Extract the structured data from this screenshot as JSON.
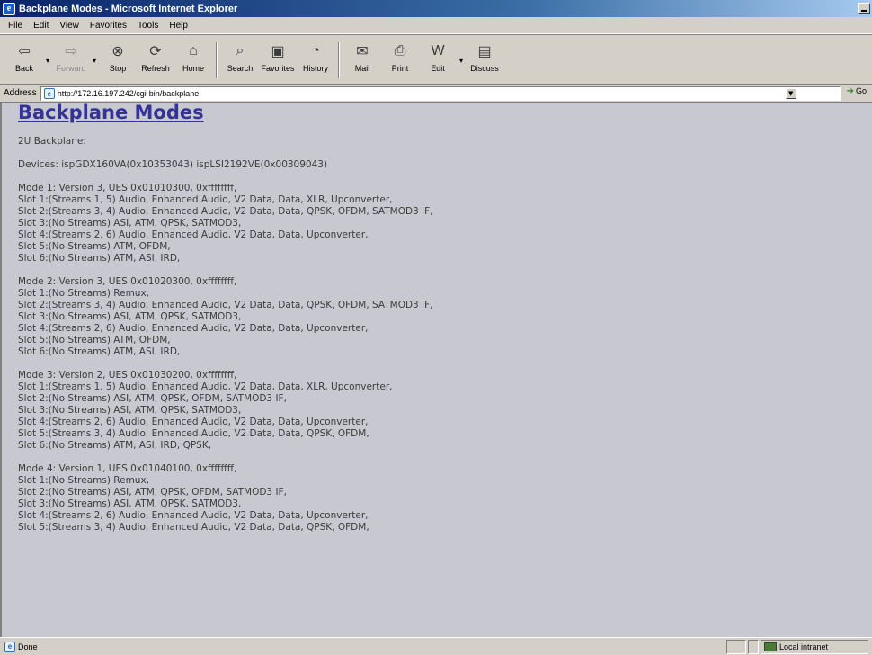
{
  "window": {
    "title": "Backplane Modes - Microsoft Internet Explorer"
  },
  "menu": [
    "File",
    "Edit",
    "View",
    "Favorites",
    "Tools",
    "Help"
  ],
  "toolbar": {
    "back": "Back",
    "forward": "Forward",
    "stop": "Stop",
    "refresh": "Refresh",
    "home": "Home",
    "search": "Search",
    "favorites": "Favorites",
    "history": "History",
    "mail": "Mail",
    "print": "Print",
    "edit": "Edit",
    "discuss": "Discuss"
  },
  "address": {
    "label": "Address",
    "url": "http://172.16.197.242/cgi-bin/backplane",
    "go": "Go"
  },
  "page": {
    "heading": "Backplane Modes",
    "backplane": "2U Backplane:",
    "devices": "Devices: ispGDX160VA(0x10353043) ispLSI2192VE(0x00309043)",
    "modes": [
      {
        "header": "Mode 1: Version 3, UES 0x01010300, 0xffffffff,",
        "slots": [
          "Slot 1:(Streams 1, 5) Audio, Enhanced Audio, V2 Data, Data, XLR, Upconverter,",
          "Slot 2:(Streams 3, 4) Audio, Enhanced Audio, V2 Data, Data, QPSK, OFDM, SATMOD3 IF,",
          "Slot 3:(No Streams) ASI, ATM, QPSK, SATMOD3,",
          "Slot 4:(Streams 2, 6) Audio, Enhanced Audio, V2 Data, Data, Upconverter,",
          "Slot 5:(No Streams) ATM, OFDM,",
          "Slot 6:(No Streams) ATM, ASI, IRD,"
        ]
      },
      {
        "header": "Mode 2: Version 3, UES 0x01020300, 0xffffffff,",
        "slots": [
          "Slot 1:(No Streams) Remux,",
          "Slot 2:(Streams 3, 4) Audio, Enhanced Audio, V2 Data, Data, QPSK, OFDM, SATMOD3 IF,",
          "Slot 3:(No Streams) ASI, ATM, QPSK, SATMOD3,",
          "Slot 4:(Streams 2, 6) Audio, Enhanced Audio, V2 Data, Data, Upconverter,",
          "Slot 5:(No Streams) ATM, OFDM,",
          "Slot 6:(No Streams) ATM, ASI, IRD,"
        ]
      },
      {
        "header": "Mode 3: Version 2, UES 0x01030200, 0xffffffff,",
        "slots": [
          "Slot 1:(Streams 1, 5) Audio, Enhanced Audio, V2 Data, Data, XLR, Upconverter,",
          "Slot 2:(No Streams) ASI, ATM, QPSK, OFDM, SATMOD3 IF,",
          "Slot 3:(No Streams) ASI, ATM, QPSK, SATMOD3,",
          "Slot 4:(Streams 2, 6) Audio, Enhanced Audio, V2 Data, Data, Upconverter,",
          "Slot 5:(Streams 3, 4) Audio, Enhanced Audio, V2 Data, Data, QPSK, OFDM,",
          "Slot 6:(No Streams) ATM, ASI, IRD, QPSK,"
        ]
      },
      {
        "header": "Mode 4: Version 1, UES 0x01040100, 0xffffffff,",
        "slots": [
          "Slot 1:(No Streams) Remux,",
          "Slot 2:(No Streams) ASI, ATM, QPSK, OFDM, SATMOD3 IF,",
          "Slot 3:(No Streams) ASI, ATM, QPSK, SATMOD3,",
          "Slot 4:(Streams 2, 6) Audio, Enhanced Audio, V2 Data, Data, Upconverter,",
          "Slot 5:(Streams 3, 4) Audio, Enhanced Audio, V2 Data, Data, QPSK, OFDM,"
        ]
      }
    ]
  },
  "status": {
    "text": "Done",
    "zone": "Local intranet"
  },
  "colors": {
    "content_bg": "#c8c8d0",
    "heading": "#333399",
    "chrome": "#d4d0c8",
    "titlebar": "#0a246a"
  }
}
